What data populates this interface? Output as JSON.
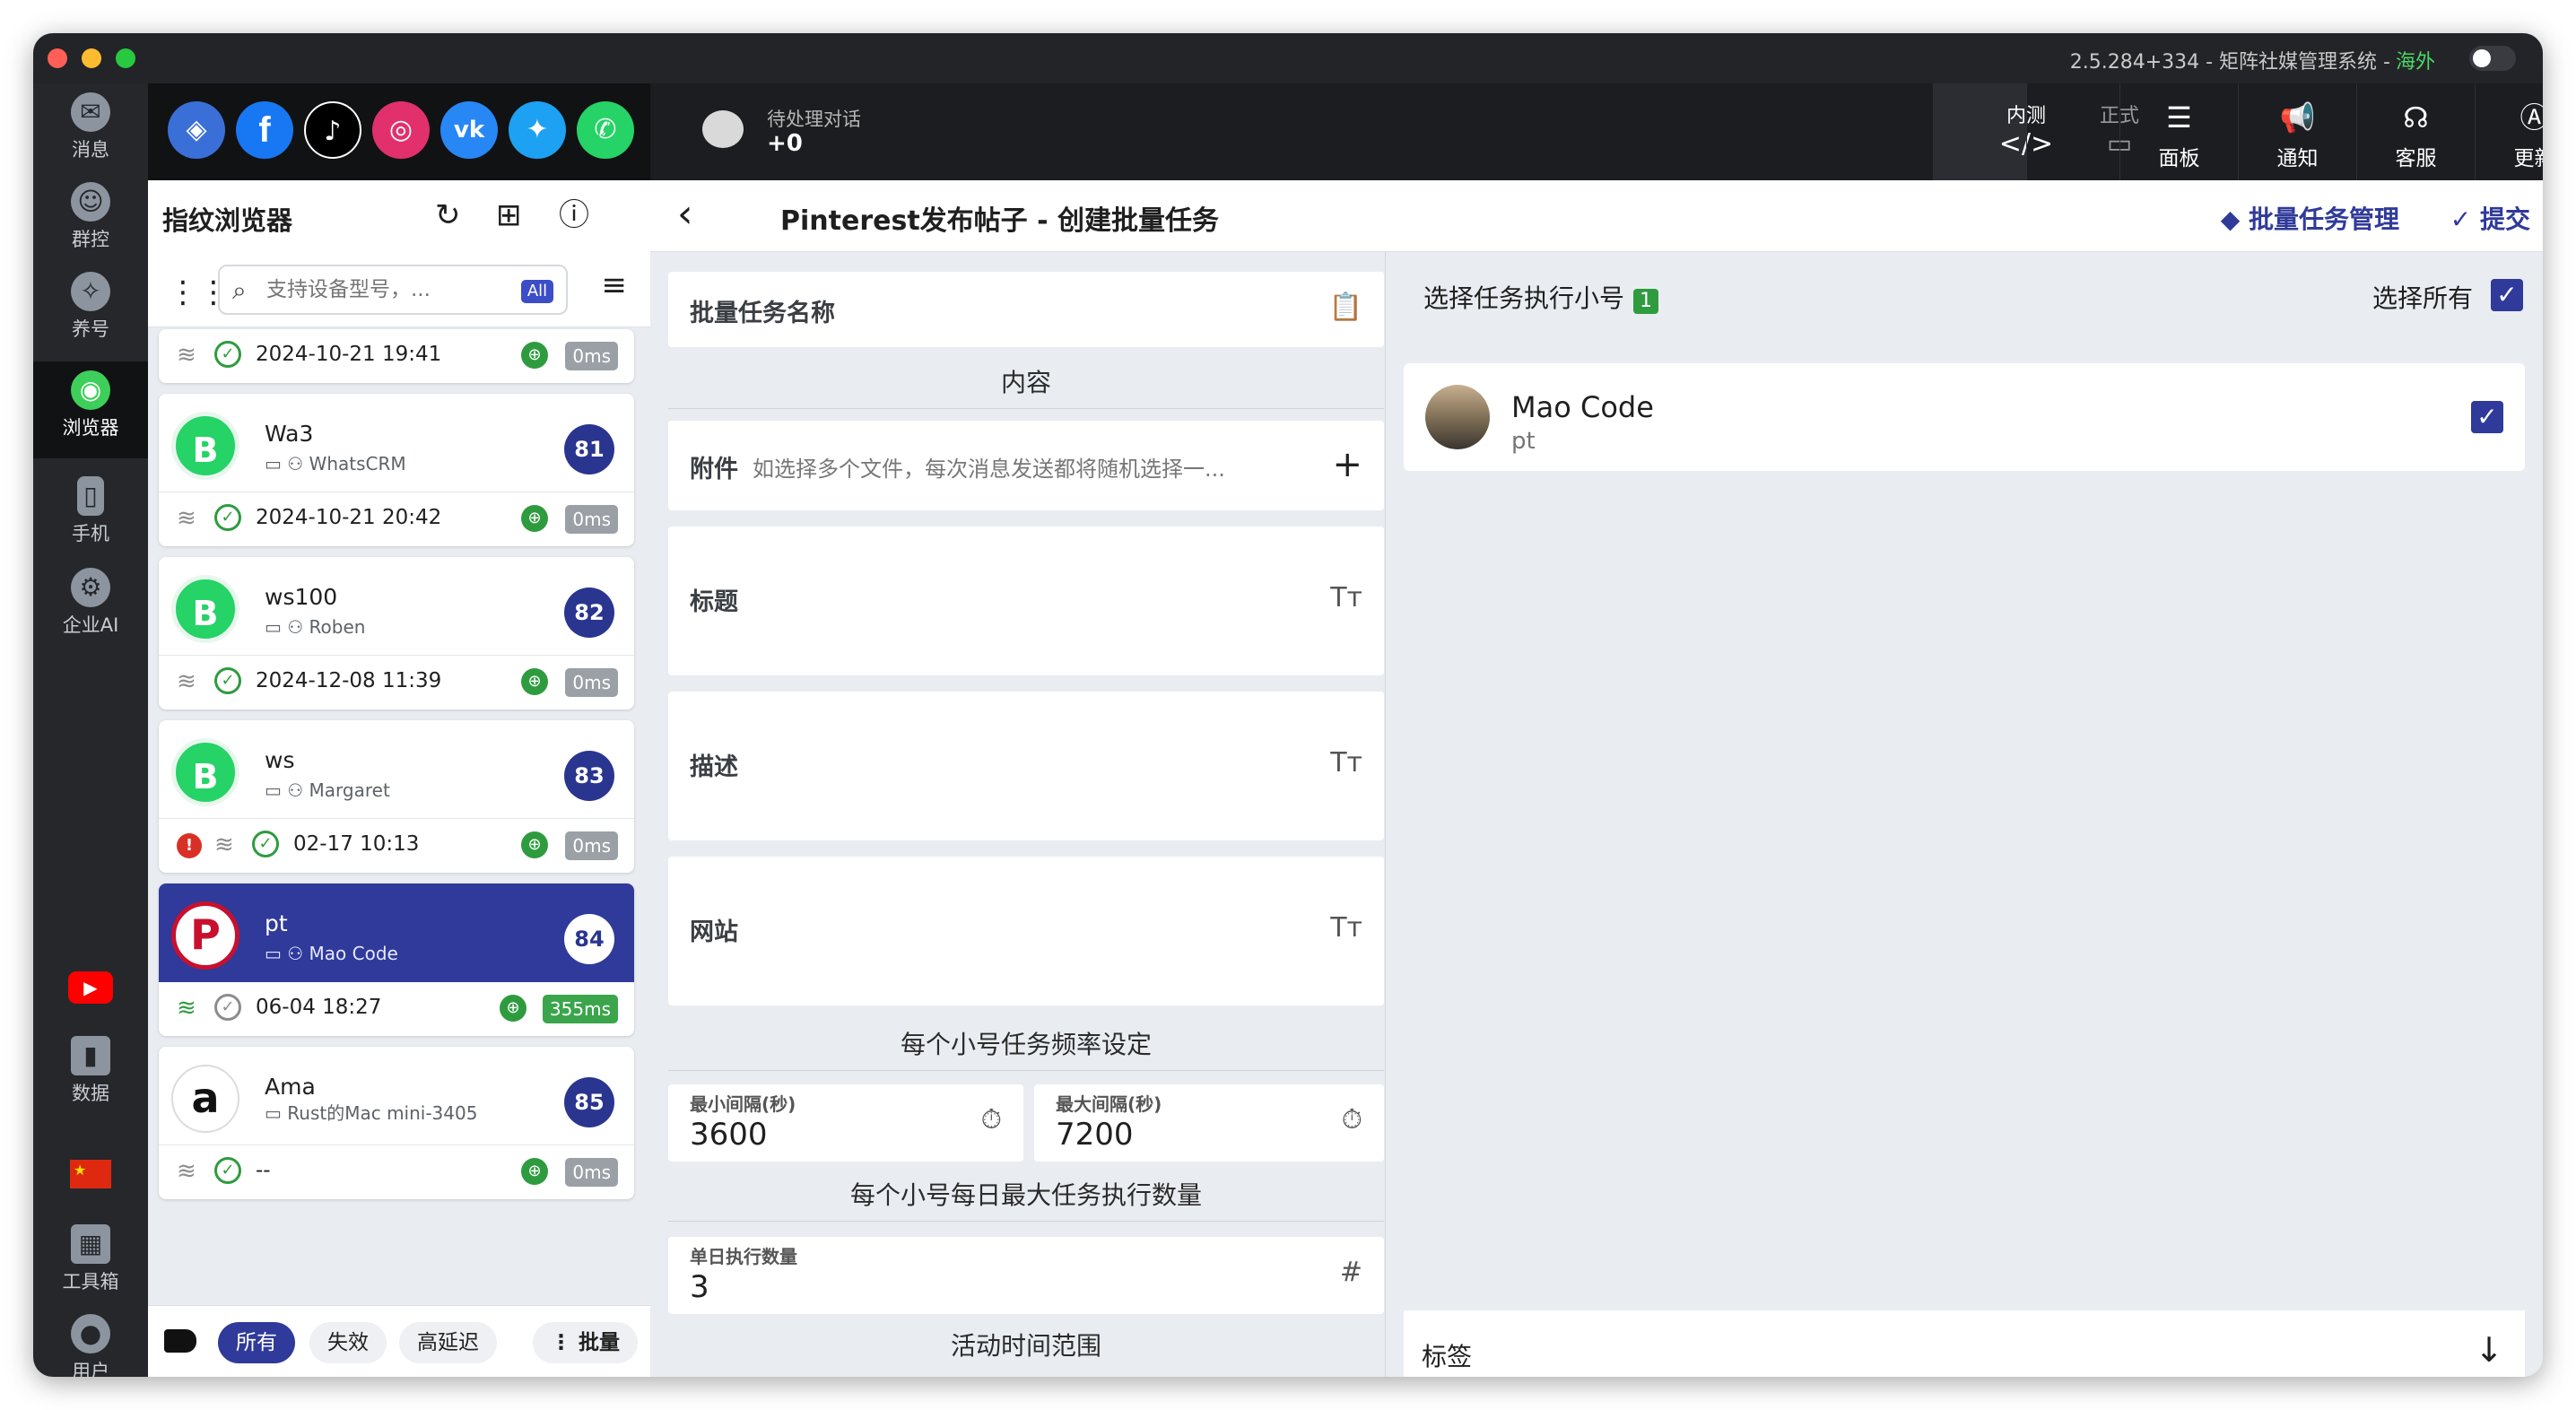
{
  "window": {
    "title": "2.5.284+334 - 矩阵社媒管理系统 - ",
    "region": "海外"
  },
  "leftnav": {
    "items": [
      {
        "label": "消息",
        "icon": "message-icon"
      },
      {
        "label": "群控",
        "icon": "group-control-icon"
      },
      {
        "label": "养号",
        "icon": "account-nurture-icon"
      },
      {
        "label": "浏览器",
        "icon": "browser-icon"
      },
      {
        "label": "手机",
        "icon": "phone-icon"
      },
      {
        "label": "企业AI",
        "icon": "ai-icon"
      },
      {
        "label": "数据",
        "icon": "data-icon"
      },
      {
        "label": "工具箱",
        "icon": "toolbox-icon"
      },
      {
        "label": "用户",
        "icon": "user-icon"
      }
    ]
  },
  "socials": [
    {
      "name": "custom-browser",
      "glyph": "◈",
      "color": "#3b6fd8"
    },
    {
      "name": "facebook",
      "glyph": "f",
      "color": "#1877f2"
    },
    {
      "name": "tiktok",
      "glyph": "♪",
      "color": "#000000"
    },
    {
      "name": "instagram",
      "glyph": "◎",
      "color": "#e1306c"
    },
    {
      "name": "vk",
      "glyph": "vk",
      "color": "#2787f5"
    },
    {
      "name": "twitter",
      "glyph": "✦",
      "color": "#1da1f2"
    },
    {
      "name": "whatsapp",
      "glyph": "✆",
      "color": "#25d366"
    }
  ],
  "topbar": {
    "pending_label": "待处理对话",
    "pending_count": "+0",
    "env_test": "内测",
    "env_prod": "正式",
    "buttons": [
      {
        "label": "面板",
        "icon": "panel-icon"
      },
      {
        "label": "通知",
        "icon": "notification-icon"
      },
      {
        "label": "客服",
        "icon": "support-icon"
      },
      {
        "label": "更新",
        "icon": "update-icon"
      }
    ]
  },
  "browser_panel": {
    "title": "指纹浏览器",
    "search_placeholder": "支持设备型号，...",
    "all_badge": "All",
    "cards": [
      {
        "name": "",
        "sub": "",
        "num": "",
        "time": "2024-10-21 19:41",
        "latency": "0ms"
      },
      {
        "name": "Wa3",
        "sub": "WhatsCRM",
        "num": "81",
        "time": "2024-10-21 20:42",
        "latency": "0ms"
      },
      {
        "name": "ws100",
        "sub": "Roben",
        "num": "82",
        "time": "2024-12-08 11:39",
        "latency": "0ms"
      },
      {
        "name": "ws",
        "sub": "Margaret",
        "num": "83",
        "time": "02-17 10:13",
        "latency": "0ms"
      },
      {
        "name": "pt",
        "sub": "Mao Code",
        "num": "84",
        "time": "06-04 18:27",
        "latency": "355ms"
      },
      {
        "name": "Ama",
        "sub": "Rust的Mac mini-3405",
        "num": "85",
        "time": "--",
        "latency": "0ms"
      }
    ],
    "footer": {
      "all": "所有",
      "invalid": "失效",
      "high_latency": "高延迟",
      "batch": "批量"
    }
  },
  "content": {
    "title": "Pinterest发布帖子 - 创建批量任务",
    "manage_link": "批量任务管理",
    "submit": "提交",
    "task_name_label": "批量任务名称",
    "content_section": "内容",
    "attachment_label": "附件",
    "attachment_hint": "如选择多个文件，每次消息发送都将随机选择一...",
    "title_label": "标题",
    "desc_label": "描述",
    "website_label": "网站",
    "freq_section": "每个小号任务频率设定",
    "min_interval_label": "最小间隔(秒)",
    "min_interval_value": "3600",
    "max_interval_label": "最大间隔(秒)",
    "max_interval_value": "7200",
    "daily_section": "每个小号每日最大任务执行数量",
    "daily_label": "单日执行数量",
    "daily_value": "3",
    "active_section": "活动时间范围"
  },
  "accounts": {
    "title": "选择任务执行小号",
    "count": "1",
    "select_all": "选择所有",
    "items": [
      {
        "name": "Mao Code",
        "sub": "pt"
      }
    ],
    "tags_label": "标签"
  }
}
